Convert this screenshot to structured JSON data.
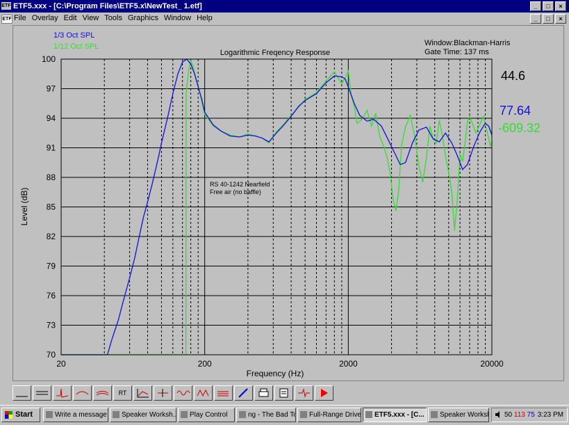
{
  "window": {
    "title": "ETF5.xxx - [C:\\Program Files\\ETF5.x\\NewTest_ 1.etf]",
    "app_icon": "ETF",
    "controls": [
      "_",
      "□",
      "×"
    ]
  },
  "menu": {
    "doc_icon": "ETF",
    "items": [
      "File",
      "Overlay",
      "Edit",
      "View",
      "Tools",
      "Graphics",
      "Window",
      "Help"
    ]
  },
  "legend": {
    "series1": "1/3 Oct SPL",
    "series2": "1/12 Oct SPL",
    "info_window": "Window:Blackman-Harris",
    "info_gate": "Gate Time: 137 ms"
  },
  "readouts": {
    "top": "44.6",
    "blue": "77.64",
    "green": "-609.32"
  },
  "annotation": {
    "line1": "RS 40-1242 Nearfield",
    "line2": "Free air (no baffle)"
  },
  "colors": {
    "series1": "#1010e0",
    "series2": "#33dd33",
    "background": "#c0c0c0"
  },
  "chart_data": {
    "type": "line",
    "title": "Logarithmic Freqency Response",
    "xlabel": "Frequency (Hz)",
    "ylabel": "Level (dB)",
    "xscale": "log",
    "xlim": [
      20,
      20000
    ],
    "ylim": [
      70,
      100
    ],
    "xticks": [
      "20",
      "200",
      "2000",
      "20000"
    ],
    "yticks": [
      "100",
      "97",
      "94",
      "91",
      "88",
      "85",
      "82",
      "79",
      "76",
      "73",
      "70"
    ],
    "grid": true,
    "series": [
      {
        "name": "1/3 Oct SPL",
        "x": [
          20,
          42,
          45,
          50,
          55,
          60,
          65,
          70,
          75,
          80,
          85,
          90,
          95,
          100,
          110,
          120,
          130,
          140,
          150,
          160,
          170,
          180,
          190,
          200,
          230,
          260,
          300,
          350,
          400,
          450,
          500,
          560,
          630,
          700,
          800,
          900,
          1000,
          1200,
          1400,
          1600,
          1800,
          1900,
          2000,
          2200,
          2400,
          2700,
          3000,
          3400,
          3800,
          4200,
          4600,
          5000,
          5600,
          6200,
          7000,
          7800,
          8600,
          9500,
          10500,
          11500,
          12500,
          13500,
          15000,
          16500,
          18000,
          19000,
          20000
        ],
        "y": [
          70,
          70,
          71.5,
          73.5,
          75.8,
          77.8,
          79.8,
          82,
          84,
          85.5,
          87,
          88.5,
          90,
          91.5,
          94,
          96.5,
          98.5,
          99.7,
          100,
          99.5,
          98.5,
          97.2,
          96,
          94.6,
          93.3,
          92.7,
          92.2,
          92.1,
          92.3,
          92.2,
          92,
          91.6,
          92.5,
          93.2,
          94.2,
          95.2,
          95.8,
          96.5,
          97.6,
          98.3,
          98.2,
          98,
          97.2,
          95.5,
          94.3,
          93.7,
          93.9,
          93.2,
          91.8,
          90.5,
          89.3,
          89.5,
          91.5,
          92.8,
          93.1,
          91.9,
          91.6,
          92.5,
          91.5,
          90.2,
          88.8,
          89.3,
          91.2,
          92.6,
          93.5,
          93.2,
          92.3
        ]
      },
      {
        "name": "1/12 Oct SPL",
        "x": [
          20,
          148,
          148.5,
          155,
          160,
          165,
          170,
          180,
          190,
          200,
          230,
          260,
          300,
          350,
          400,
          450,
          500,
          560,
          630,
          700,
          800,
          900,
          1000,
          1200,
          1400,
          1600,
          1800,
          1900,
          2000,
          2100,
          2200,
          2300,
          2500,
          2700,
          2900,
          3100,
          3300,
          3500,
          3700,
          3900,
          4100,
          4300,
          4500,
          4700,
          5000,
          5400,
          5800,
          6200,
          6600,
          7000,
          7400,
          7800,
          8200,
          8600,
          9000,
          9500,
          10000,
          10500,
          11000,
          11500,
          12000,
          12500,
          13000,
          13500,
          14000,
          14500,
          15500,
          16500,
          17500,
          18500,
          19500,
          20000
        ],
        "y": [
          70,
          70,
          96.5,
          99,
          99.8,
          99.4,
          98.6,
          97.3,
          95.8,
          94.4,
          93.2,
          92.7,
          92.3,
          92.1,
          92.4,
          92.2,
          92,
          91.5,
          92.6,
          93.3,
          94.3,
          95.1,
          95.9,
          96.6,
          97.8,
          98.7,
          97.5,
          98.1,
          98.8,
          96.3,
          95.2,
          93.5,
          93.9,
          94.8,
          93.2,
          94.5,
          92.2,
          91.3,
          90.2,
          88.6,
          85.8,
          84.6,
          86.8,
          91.3,
          93.1,
          94.3,
          92.2,
          89.2,
          87.5,
          90,
          93.2,
          91.9,
          91.5,
          93.8,
          92.4,
          90.2,
          88.5,
          86.6,
          82.6,
          85.8,
          90.4,
          89.6,
          91.4,
          93.6,
          94.2,
          93.6,
          92.5,
          93.4,
          94.2,
          92.7,
          91.2,
          91.6
        ]
      }
    ]
  }
}
